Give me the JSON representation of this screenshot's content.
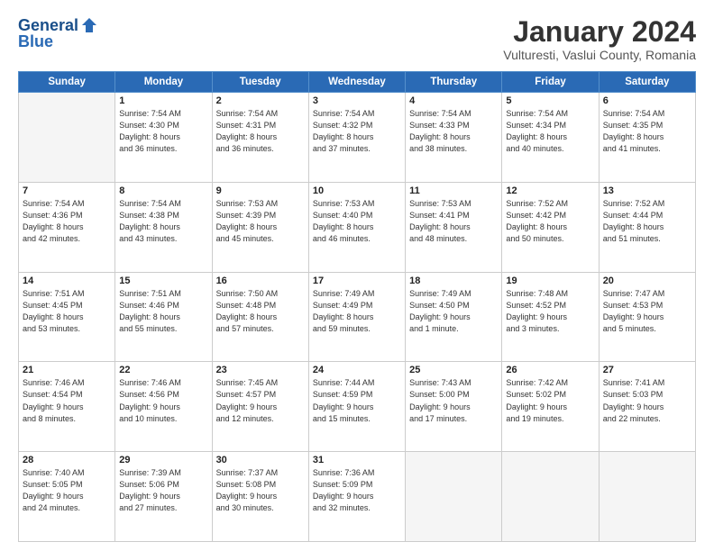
{
  "header": {
    "logo_line1": "General",
    "logo_line2": "Blue",
    "month": "January 2024",
    "location": "Vulturesti, Vaslui County, Romania"
  },
  "weekdays": [
    "Sunday",
    "Monday",
    "Tuesday",
    "Wednesday",
    "Thursday",
    "Friday",
    "Saturday"
  ],
  "weeks": [
    [
      {
        "day": "",
        "info": ""
      },
      {
        "day": "1",
        "info": "Sunrise: 7:54 AM\nSunset: 4:30 PM\nDaylight: 8 hours\nand 36 minutes."
      },
      {
        "day": "2",
        "info": "Sunrise: 7:54 AM\nSunset: 4:31 PM\nDaylight: 8 hours\nand 36 minutes."
      },
      {
        "day": "3",
        "info": "Sunrise: 7:54 AM\nSunset: 4:32 PM\nDaylight: 8 hours\nand 37 minutes."
      },
      {
        "day": "4",
        "info": "Sunrise: 7:54 AM\nSunset: 4:33 PM\nDaylight: 8 hours\nand 38 minutes."
      },
      {
        "day": "5",
        "info": "Sunrise: 7:54 AM\nSunset: 4:34 PM\nDaylight: 8 hours\nand 40 minutes."
      },
      {
        "day": "6",
        "info": "Sunrise: 7:54 AM\nSunset: 4:35 PM\nDaylight: 8 hours\nand 41 minutes."
      }
    ],
    [
      {
        "day": "7",
        "info": "Sunrise: 7:54 AM\nSunset: 4:36 PM\nDaylight: 8 hours\nand 42 minutes."
      },
      {
        "day": "8",
        "info": "Sunrise: 7:54 AM\nSunset: 4:38 PM\nDaylight: 8 hours\nand 43 minutes."
      },
      {
        "day": "9",
        "info": "Sunrise: 7:53 AM\nSunset: 4:39 PM\nDaylight: 8 hours\nand 45 minutes."
      },
      {
        "day": "10",
        "info": "Sunrise: 7:53 AM\nSunset: 4:40 PM\nDaylight: 8 hours\nand 46 minutes."
      },
      {
        "day": "11",
        "info": "Sunrise: 7:53 AM\nSunset: 4:41 PM\nDaylight: 8 hours\nand 48 minutes."
      },
      {
        "day": "12",
        "info": "Sunrise: 7:52 AM\nSunset: 4:42 PM\nDaylight: 8 hours\nand 50 minutes."
      },
      {
        "day": "13",
        "info": "Sunrise: 7:52 AM\nSunset: 4:44 PM\nDaylight: 8 hours\nand 51 minutes."
      }
    ],
    [
      {
        "day": "14",
        "info": "Sunrise: 7:51 AM\nSunset: 4:45 PM\nDaylight: 8 hours\nand 53 minutes."
      },
      {
        "day": "15",
        "info": "Sunrise: 7:51 AM\nSunset: 4:46 PM\nDaylight: 8 hours\nand 55 minutes."
      },
      {
        "day": "16",
        "info": "Sunrise: 7:50 AM\nSunset: 4:48 PM\nDaylight: 8 hours\nand 57 minutes."
      },
      {
        "day": "17",
        "info": "Sunrise: 7:49 AM\nSunset: 4:49 PM\nDaylight: 8 hours\nand 59 minutes."
      },
      {
        "day": "18",
        "info": "Sunrise: 7:49 AM\nSunset: 4:50 PM\nDaylight: 9 hours\nand 1 minute."
      },
      {
        "day": "19",
        "info": "Sunrise: 7:48 AM\nSunset: 4:52 PM\nDaylight: 9 hours\nand 3 minutes."
      },
      {
        "day": "20",
        "info": "Sunrise: 7:47 AM\nSunset: 4:53 PM\nDaylight: 9 hours\nand 5 minutes."
      }
    ],
    [
      {
        "day": "21",
        "info": "Sunrise: 7:46 AM\nSunset: 4:54 PM\nDaylight: 9 hours\nand 8 minutes."
      },
      {
        "day": "22",
        "info": "Sunrise: 7:46 AM\nSunset: 4:56 PM\nDaylight: 9 hours\nand 10 minutes."
      },
      {
        "day": "23",
        "info": "Sunrise: 7:45 AM\nSunset: 4:57 PM\nDaylight: 9 hours\nand 12 minutes."
      },
      {
        "day": "24",
        "info": "Sunrise: 7:44 AM\nSunset: 4:59 PM\nDaylight: 9 hours\nand 15 minutes."
      },
      {
        "day": "25",
        "info": "Sunrise: 7:43 AM\nSunset: 5:00 PM\nDaylight: 9 hours\nand 17 minutes."
      },
      {
        "day": "26",
        "info": "Sunrise: 7:42 AM\nSunset: 5:02 PM\nDaylight: 9 hours\nand 19 minutes."
      },
      {
        "day": "27",
        "info": "Sunrise: 7:41 AM\nSunset: 5:03 PM\nDaylight: 9 hours\nand 22 minutes."
      }
    ],
    [
      {
        "day": "28",
        "info": "Sunrise: 7:40 AM\nSunset: 5:05 PM\nDaylight: 9 hours\nand 24 minutes."
      },
      {
        "day": "29",
        "info": "Sunrise: 7:39 AM\nSunset: 5:06 PM\nDaylight: 9 hours\nand 27 minutes."
      },
      {
        "day": "30",
        "info": "Sunrise: 7:37 AM\nSunset: 5:08 PM\nDaylight: 9 hours\nand 30 minutes."
      },
      {
        "day": "31",
        "info": "Sunrise: 7:36 AM\nSunset: 5:09 PM\nDaylight: 9 hours\nand 32 minutes."
      },
      {
        "day": "",
        "info": ""
      },
      {
        "day": "",
        "info": ""
      },
      {
        "day": "",
        "info": ""
      }
    ]
  ]
}
